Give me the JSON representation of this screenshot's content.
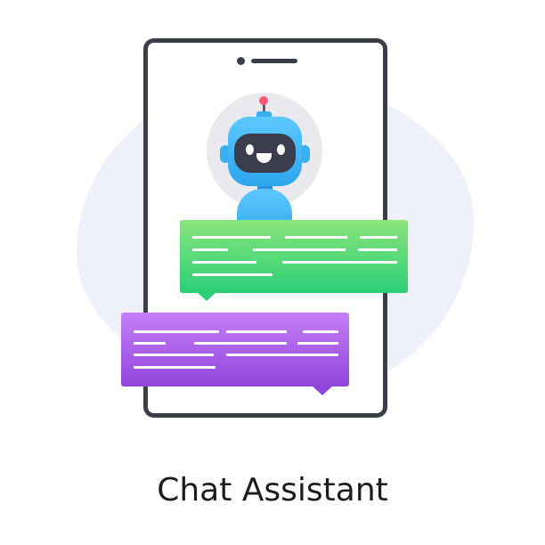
{
  "caption": "Chat Assistant",
  "icons": [
    "robot-icon",
    "smartphone-icon",
    "chat-bubble-icon"
  ],
  "colors": {
    "phone_frame": "#3a3d4a",
    "robot_blue": "#3bb0f0",
    "antenna_tip": "#ff5a78",
    "bubble_green": "#2bcf77",
    "bubble_purple": "#8f46dc",
    "background_blob": "#eef1fa"
  }
}
